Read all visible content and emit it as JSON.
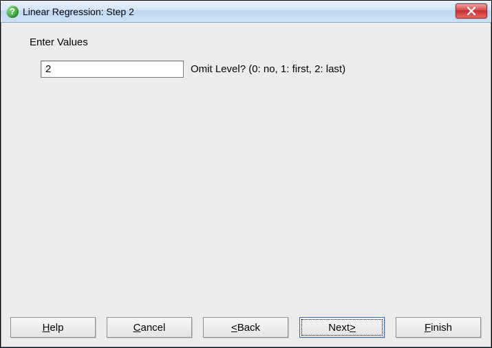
{
  "window": {
    "title": "Linear Regression: Step 2"
  },
  "content": {
    "heading": "Enter Values",
    "input_value": "2",
    "input_label": "Omit Level? (0: no, 1: first, 2: last)"
  },
  "buttons": {
    "help": {
      "before": "",
      "accel": "H",
      "after": "elp"
    },
    "cancel": {
      "before": "",
      "accel": "C",
      "after": "ancel"
    },
    "back": {
      "before": "",
      "accel": "<",
      "after": " Back"
    },
    "next": {
      "before": "Next ",
      "accel": ">",
      "after": ""
    },
    "finish": {
      "before": "",
      "accel": "F",
      "after": "inish"
    }
  }
}
